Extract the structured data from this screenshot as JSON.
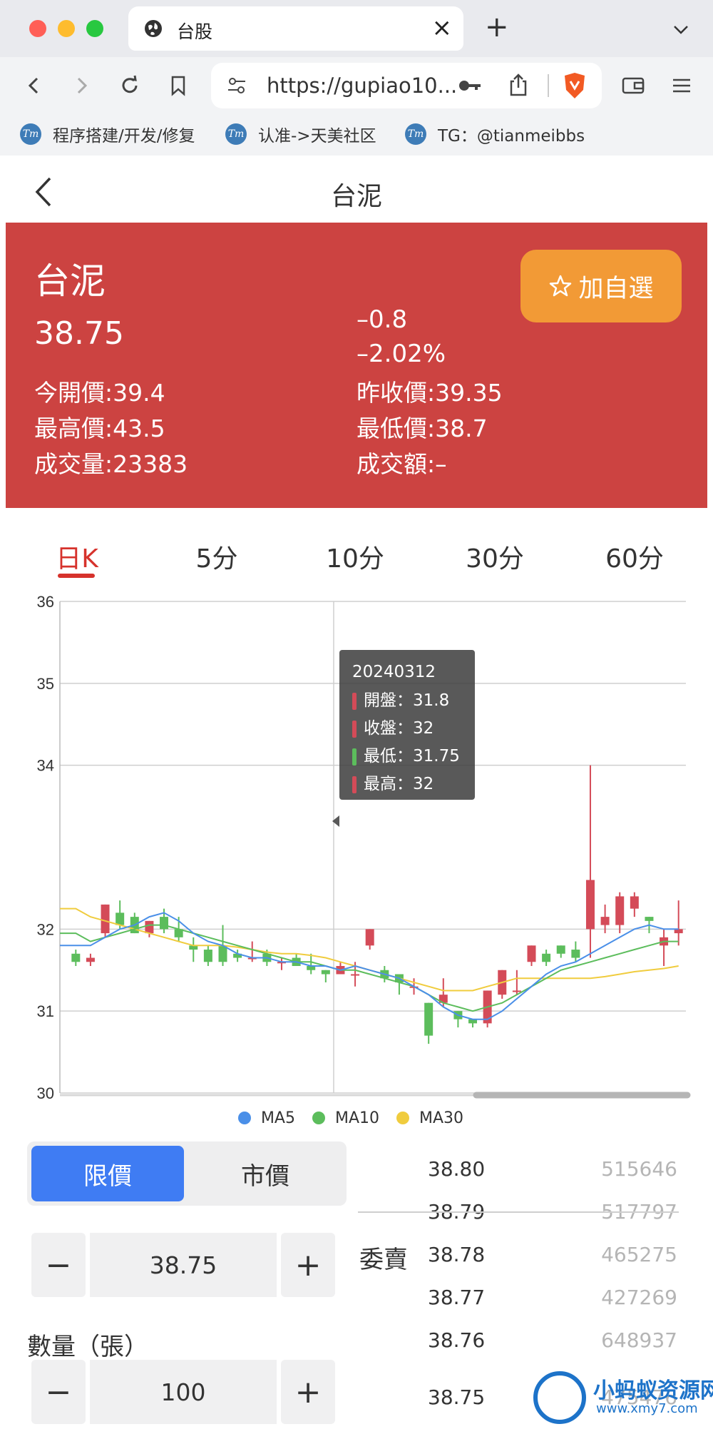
{
  "browser": {
    "tab_title": "台股",
    "url": "https://gupiao10...",
    "bookmarks": [
      "程序搭建/开发/修复",
      "认准->天美社区",
      "TG：@tianmeibbs"
    ],
    "bookmark_icon_text": "Tm"
  },
  "header": {
    "title": "台泥"
  },
  "quote": {
    "name": "台泥",
    "price": "38.75",
    "change": "–0.8",
    "change_pct": "–2.02%",
    "favorite_label": "加自選",
    "open": "今開價:39.4",
    "prev_close": "昨收價:39.35",
    "high": "最高價:43.5",
    "low": "最低價:38.7",
    "volume": "成交量:23383",
    "amount": "成交額:–"
  },
  "period_tabs": [
    "日K",
    "5分",
    "10分",
    "30分",
    "60分"
  ],
  "chart_data": {
    "type": "candlestick",
    "ylim": [
      30,
      36
    ],
    "y_ticks": [
      "36",
      "35",
      "34",
      "32",
      "31",
      "30"
    ],
    "grid": true,
    "legend_position": "bottom-center",
    "series": [
      {
        "name": "MA5",
        "color": "#4a8fe8"
      },
      {
        "name": "MA10",
        "color": "#5cbd5c"
      },
      {
        "name": "MA30",
        "color": "#f0cc3e"
      }
    ],
    "candles": [
      [
        31.7,
        31.6,
        31.75,
        31.55
      ],
      [
        31.6,
        31.65,
        31.7,
        31.55
      ],
      [
        31.95,
        32.3,
        32.3,
        31.9
      ],
      [
        32.2,
        32.05,
        32.35,
        32.0
      ],
      [
        32.15,
        31.95,
        32.2,
        31.95
      ],
      [
        31.95,
        32.1,
        32.1,
        31.9
      ],
      [
        32.15,
        32.0,
        32.25,
        31.95
      ],
      [
        32.0,
        31.9,
        32.15,
        31.85
      ],
      [
        31.8,
        31.75,
        31.9,
        31.6
      ],
      [
        31.75,
        31.6,
        31.8,
        31.55
      ],
      [
        31.8,
        31.6,
        32.05,
        31.55
      ],
      [
        31.7,
        31.65,
        31.75,
        31.6
      ],
      [
        31.65,
        31.65,
        31.85,
        31.6
      ],
      [
        31.7,
        31.6,
        31.75,
        31.55
      ],
      [
        31.6,
        31.6,
        31.65,
        31.5
      ],
      [
        31.65,
        31.55,
        31.7,
        31.55
      ],
      [
        31.55,
        31.5,
        31.7,
        31.45
      ],
      [
        31.5,
        31.45,
        31.5,
        31.35
      ],
      [
        31.45,
        31.55,
        31.6,
        31.45
      ],
      [
        31.45,
        31.45,
        31.6,
        31.3
      ],
      [
        31.8,
        32.0,
        32.0,
        31.75
      ],
      [
        31.5,
        31.4,
        31.55,
        31.35
      ],
      [
        31.45,
        31.35,
        31.45,
        31.2
      ],
      [
        31.3,
        31.3,
        31.4,
        31.2
      ],
      [
        31.1,
        30.7,
        31.1,
        30.6
      ],
      [
        31.1,
        31.2,
        31.4,
        31.05
      ],
      [
        31.0,
        30.9,
        31.0,
        30.8
      ],
      [
        30.9,
        30.85,
        30.9,
        30.8
      ],
      [
        30.85,
        31.25,
        31.25,
        30.8
      ],
      [
        31.2,
        31.5,
        31.5,
        31.15
      ],
      [
        31.25,
        31.25,
        31.5,
        31.2
      ],
      [
        31.6,
        31.8,
        31.8,
        31.55
      ],
      [
        31.7,
        31.6,
        31.75,
        31.55
      ],
      [
        31.8,
        31.7,
        31.8,
        31.65
      ],
      [
        31.75,
        31.65,
        31.85,
        31.6
      ],
      [
        32.0,
        32.6,
        34.0,
        31.65
      ],
      [
        32.05,
        32.15,
        32.3,
        31.95
      ],
      [
        32.05,
        32.4,
        32.45,
        31.95
      ],
      [
        32.25,
        32.4,
        32.45,
        32.15
      ],
      [
        32.15,
        32.1,
        32.15,
        31.95
      ],
      [
        31.8,
        31.9,
        32.0,
        31.55
      ],
      [
        31.95,
        32.0,
        32.35,
        31.8
      ]
    ],
    "ma5": [
      31.8,
      31.8,
      31.9,
      32.0,
      32.05,
      32.15,
      32.2,
      32.1,
      31.95,
      31.85,
      31.8,
      31.7,
      31.65,
      31.65,
      31.6,
      31.6,
      31.55,
      31.55,
      31.5,
      31.55,
      31.5,
      31.45,
      31.4,
      31.3,
      31.2,
      31.05,
      30.95,
      30.9,
      30.9,
      31.0,
      31.15,
      31.3,
      31.45,
      31.55,
      31.6,
      31.7,
      31.8,
      31.9,
      32.0,
      32.05,
      32.0,
      32.0
    ],
    "ma10": [
      31.95,
      31.85,
      31.9,
      31.95,
      32.0,
      32.05,
      32.05,
      32.0,
      31.95,
      31.9,
      31.85,
      31.8,
      31.75,
      31.7,
      31.65,
      31.6,
      31.6,
      31.55,
      31.5,
      31.5,
      31.45,
      31.4,
      31.35,
      31.3,
      31.2,
      31.1,
      31.05,
      31.0,
      31.05,
      31.1,
      31.2,
      31.3,
      31.4,
      31.5,
      31.55,
      31.6,
      31.65,
      31.7,
      31.75,
      31.8,
      31.85,
      31.85
    ],
    "ma30": [
      32.25,
      32.15,
      32.1,
      32.05,
      32.0,
      31.95,
      31.9,
      31.85,
      31.8,
      31.8,
      31.8,
      31.78,
      31.75,
      31.72,
      31.7,
      31.7,
      31.68,
      31.65,
      31.6,
      31.55,
      31.5,
      31.45,
      31.4,
      31.35,
      31.3,
      31.25,
      31.25,
      31.25,
      31.3,
      31.35,
      31.4,
      31.4,
      31.4,
      31.4,
      31.4,
      31.4,
      31.42,
      31.45,
      31.48,
      31.5,
      31.52,
      31.55
    ],
    "tooltip": {
      "date": "20240312",
      "rows": [
        {
          "label": "開盤：31.8",
          "color": "#d44b58"
        },
        {
          "label": "收盤：32",
          "color": "#d44b58"
        },
        {
          "label": "最低：31.75",
          "color": "#5cbd5c"
        },
        {
          "label": "最高：32",
          "color": "#d44b58"
        }
      ]
    }
  },
  "order": {
    "type_limit": "限價",
    "type_market": "市價",
    "price_value": "38.75",
    "qty_label": "數量（張）",
    "qty_value": "100",
    "minus": "−",
    "plus": "+"
  },
  "order_book": {
    "ask_label": "委賣",
    "asks": [
      {
        "price": "38.80",
        "volume": "515646"
      },
      {
        "price": "38.79",
        "volume": "517797"
      },
      {
        "price": "38.78",
        "volume": "465275"
      },
      {
        "price": "38.77",
        "volume": "427269"
      },
      {
        "price": "38.76",
        "volume": "648937"
      }
    ],
    "last": {
      "price": "38.75",
      "volume": "475476"
    }
  },
  "watermark": {
    "title": "小蚂蚁资源网",
    "url": "www.xmy7.com"
  }
}
